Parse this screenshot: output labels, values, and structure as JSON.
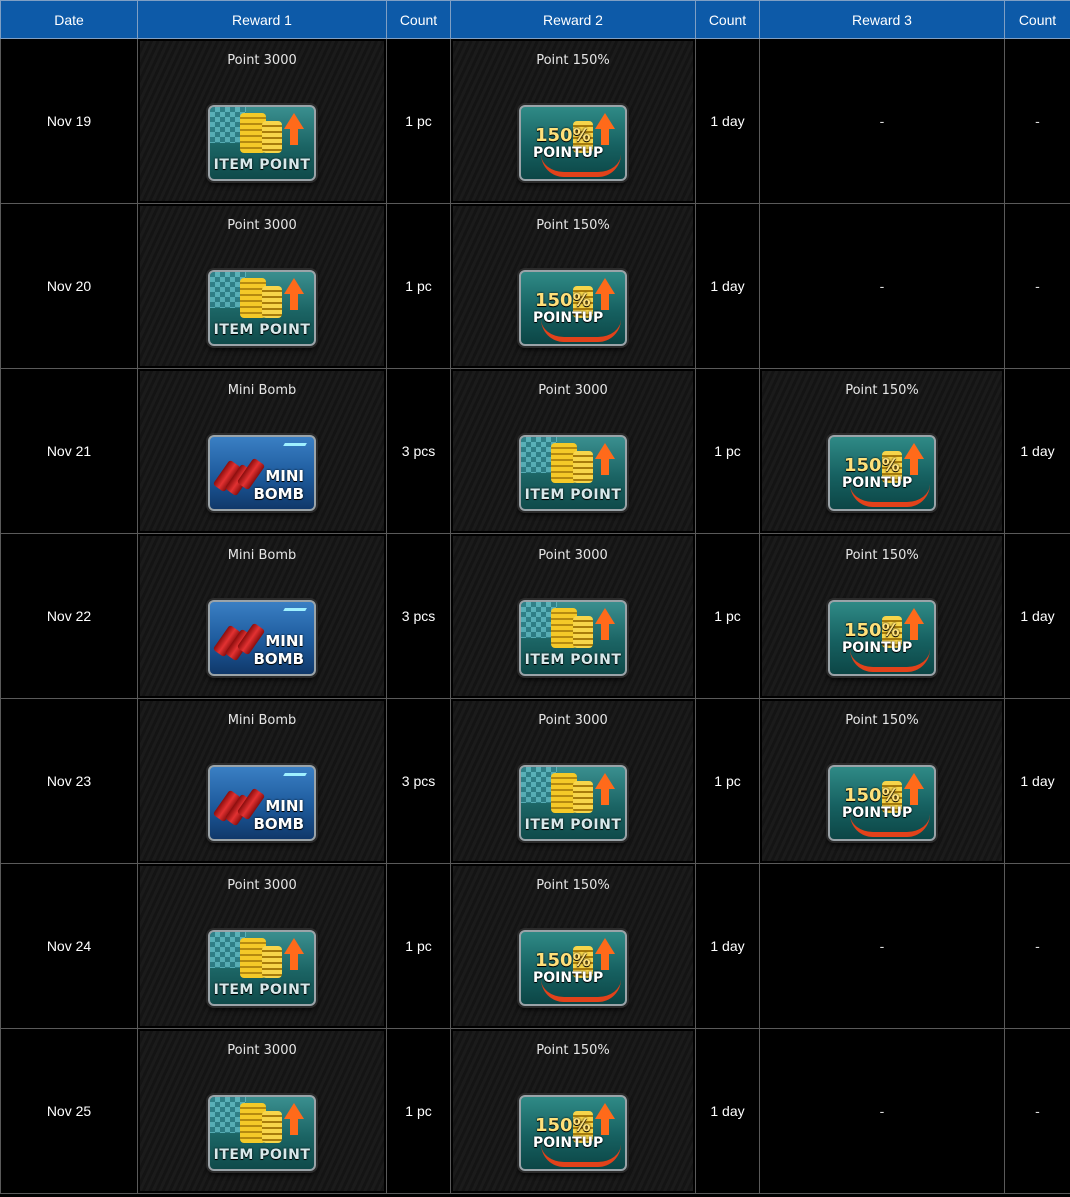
{
  "headers": [
    "Date",
    "Reward 1",
    "Count",
    "Reward 2",
    "Count",
    "Reward 3",
    "Count"
  ],
  "icon_labels": {
    "point": "ITEM POINT",
    "pointup_pct": "150%",
    "pointup_word": "POINTUP",
    "bomb_line1": "MINI",
    "bomb_line2": "BOMB"
  },
  "rows": [
    {
      "date": "Nov 19",
      "r1": {
        "name": "Point 3000",
        "icon": "point"
      },
      "c1": "1 pc",
      "r2": {
        "name": "Point 150%",
        "icon": "pointup"
      },
      "c2": "1 day",
      "r3": null,
      "r3_text": "-",
      "c3": "-"
    },
    {
      "date": "Nov 20",
      "r1": {
        "name": "Point 3000",
        "icon": "point"
      },
      "c1": "1 pc",
      "r2": {
        "name": "Point 150%",
        "icon": "pointup"
      },
      "c2": "1 day",
      "r3": null,
      "r3_text": "-",
      "c3": "-"
    },
    {
      "date": "Nov 21",
      "r1": {
        "name": "Mini Bomb",
        "icon": "bomb"
      },
      "c1": "3 pcs",
      "r2": {
        "name": "Point 3000",
        "icon": "point"
      },
      "c2": "1 pc",
      "r3": {
        "name": "Point 150%",
        "icon": "pointup"
      },
      "c3": "1 day"
    },
    {
      "date": "Nov 22",
      "r1": {
        "name": "Mini Bomb",
        "icon": "bomb"
      },
      "c1": "3 pcs",
      "r2": {
        "name": "Point 3000",
        "icon": "point"
      },
      "c2": "1 pc",
      "r3": {
        "name": "Point 150%",
        "icon": "pointup"
      },
      "c3": "1 day"
    },
    {
      "date": "Nov 23",
      "r1": {
        "name": "Mini Bomb",
        "icon": "bomb"
      },
      "c1": "3 pcs",
      "r2": {
        "name": "Point 3000",
        "icon": "point"
      },
      "c2": "1 pc",
      "r3": {
        "name": "Point 150%",
        "icon": "pointup"
      },
      "c3": "1 day"
    },
    {
      "date": "Nov 24",
      "r1": {
        "name": "Point 3000",
        "icon": "point"
      },
      "c1": "1 pc",
      "r2": {
        "name": "Point 150%",
        "icon": "pointup"
      },
      "c2": "1 day",
      "r3": null,
      "r3_text": "-",
      "c3": "-"
    },
    {
      "date": "Nov 25",
      "r1": {
        "name": "Point 3000",
        "icon": "point"
      },
      "c1": "1 pc",
      "r2": {
        "name": "Point 150%",
        "icon": "pointup"
      },
      "c2": "1 day",
      "r3": null,
      "r3_text": "-",
      "c3": "-"
    }
  ],
  "colors": {
    "header_bg": "#0d5aa8",
    "cell_bg": "#000000",
    "border": "#5a5a5a"
  }
}
